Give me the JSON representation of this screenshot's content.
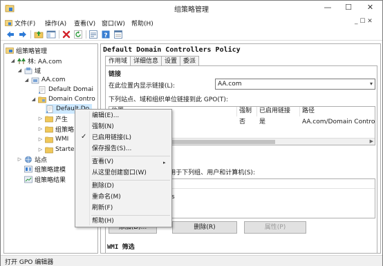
{
  "window": {
    "title": "组策略管理",
    "minimize": "—",
    "maximize": "☐",
    "close": "✕"
  },
  "menu": {
    "items": [
      "文件(F)",
      "操作(A)",
      "查看(V)",
      "窗口(W)",
      "帮助(H)"
    ],
    "child_controls": "_ ☐ ✕"
  },
  "toolbar": {
    "icons": [
      "back-icon",
      "forward-icon",
      "up-folder-icon",
      "show-hide-tree-icon",
      "delete-icon",
      "refresh-icon",
      "export-list-icon",
      "help-icon",
      "properties-icon"
    ]
  },
  "tree": {
    "root": "组策略管理",
    "forest": "林: AA.com",
    "domains": "域",
    "domain": "AA.com",
    "default_domain_policy": "Default Domai",
    "domain_controllers_ou": "Domain Contro",
    "default_dc_policy": "Default Do",
    "production": "产生",
    "gpo": "组策略",
    "wmi": "WMI",
    "starter": "Starter",
    "sites": "站点",
    "modeling": "组策略建模",
    "results": "组策略结果"
  },
  "details": {
    "title": "Default Domain Controllers Policy",
    "tabs": [
      "作用域",
      "详细信息",
      "设置",
      "委派"
    ],
    "links_heading": "链接",
    "location_label": "在此位置内显示链接(L):",
    "location_value": "AA.com",
    "linked_label": "下列站点、域和组织单位链接到此 GPO(T):",
    "columns": [
      "位置",
      "强制",
      "已启用链接",
      "路径"
    ],
    "row": {
      "location": "Domain Controllers",
      "enforced": "否",
      "enabled": "是",
      "path": "AA.com/Domain Controll"
    },
    "filter_label": "此 GPO 中的设置只应用于下列组、用户和计算机(S):",
    "filter_item": "Authenticated Users",
    "btn_add": "添加(D)...",
    "btn_remove": "删除(R)",
    "btn_properties": "属性(P)",
    "wmi_heading": "WMI 筛选"
  },
  "context_menu": {
    "items": [
      "编辑(E)...",
      "强制(N)",
      "已启用链接(L)",
      "保存报告(S)...",
      "查看(V)",
      "从这里创建窗口(W)",
      "删除(D)",
      "重命名(M)",
      "刷新(F)",
      "帮助(H)"
    ],
    "checked": "已启用链接(L)",
    "check_mark": "✓",
    "submenu_arrow": "▸"
  },
  "status": {
    "text": "打开 GPO 编辑器"
  },
  "colors": {
    "selection": "#cce8ff",
    "accent": "#0078d7"
  }
}
